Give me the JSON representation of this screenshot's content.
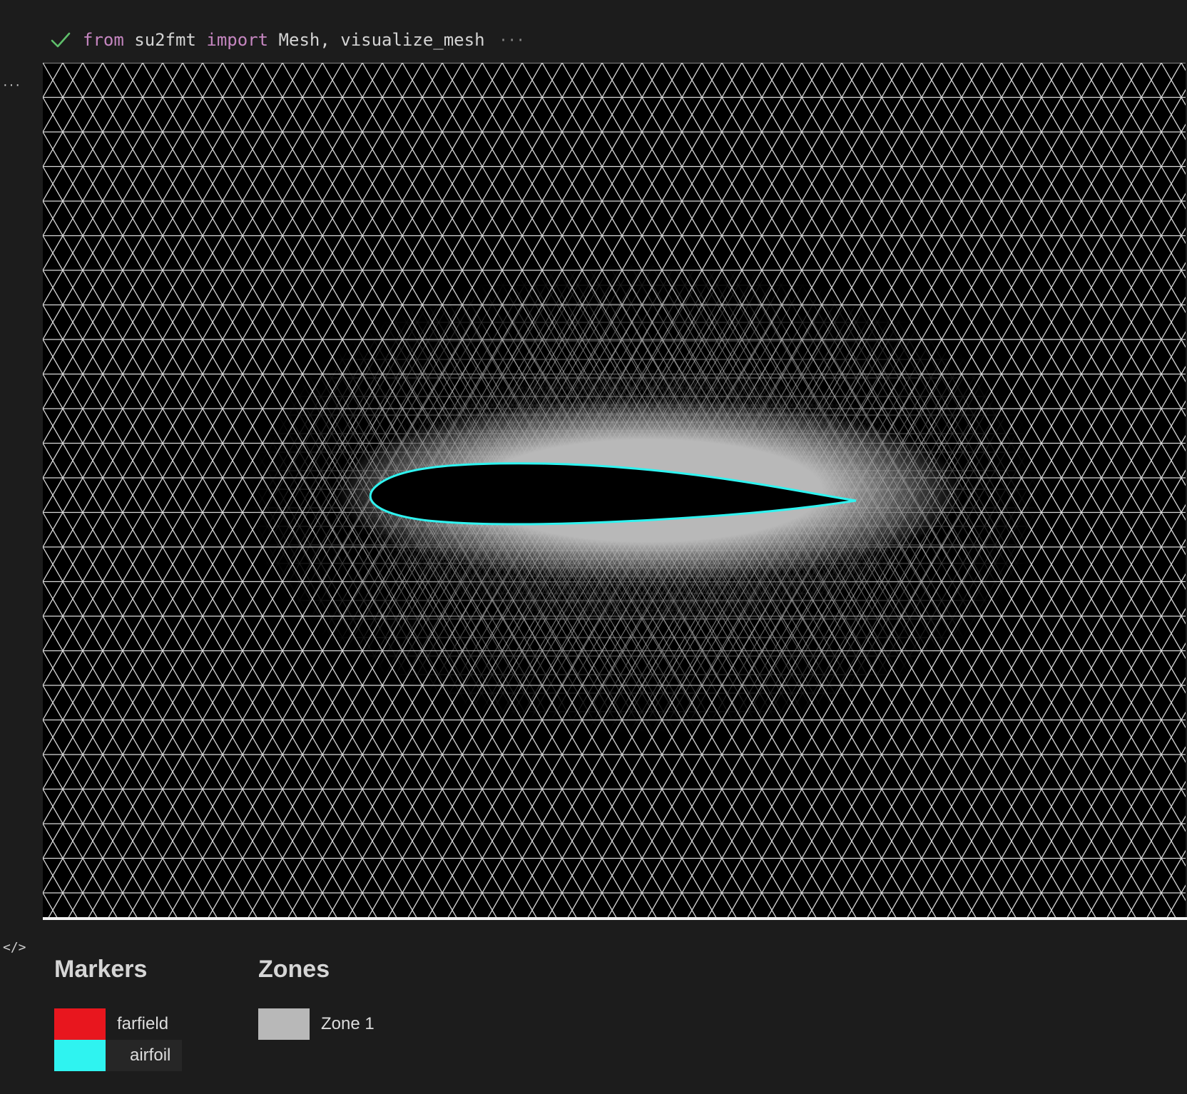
{
  "cell": {
    "code": {
      "kw_from": "from",
      "module": " su2fmt ",
      "kw_import": "import",
      "names": " Mesh, visualize_mesh"
    },
    "collapsed_indicator": "···"
  },
  "side": {
    "more_glyph": "···",
    "code_toggle_glyph": "</>"
  },
  "legend": {
    "markers_title": "Markers",
    "markers": [
      {
        "label": "farfield",
        "color": "#e8161e"
      },
      {
        "label": "airfoil",
        "color": "#2ff3f0"
      }
    ],
    "zones_title": "Zones",
    "zones": [
      {
        "label": "Zone 1",
        "color": "#b8b8b8"
      }
    ]
  },
  "mesh": {
    "mesh_line_color": "#d8d8d8",
    "airfoil_outline_color": "#2ff3f0",
    "near_field_color": "#b8b8b8",
    "background_color": "#000000"
  }
}
